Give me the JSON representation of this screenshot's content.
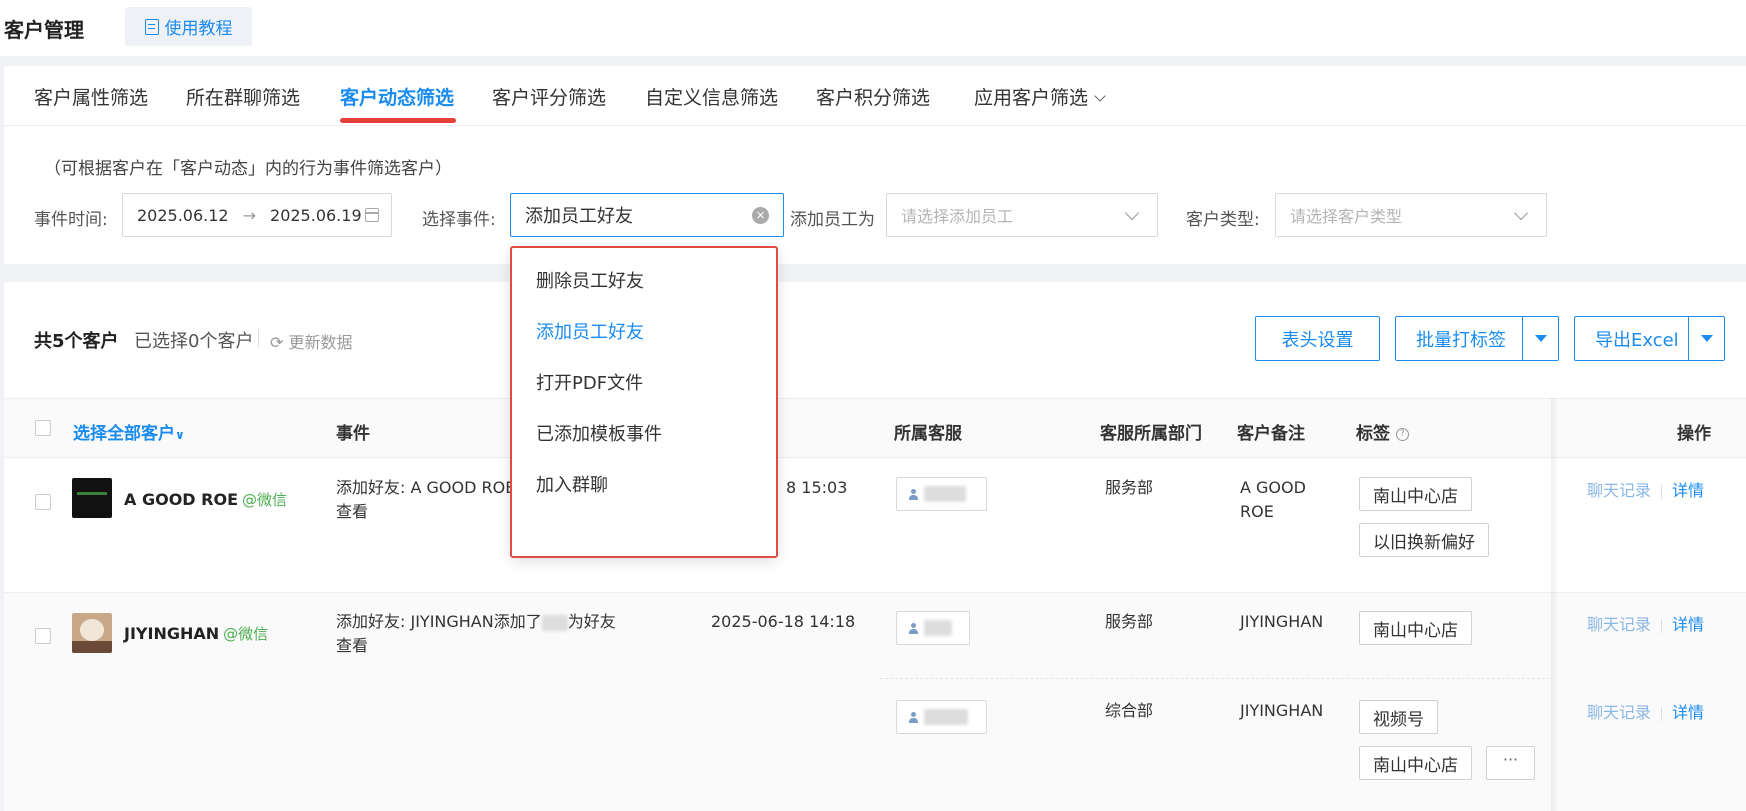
{
  "header": {
    "title": "客户管理",
    "tutorial_label": "使用教程"
  },
  "tabs": [
    {
      "label": "客户属性筛选"
    },
    {
      "label": "所在群聊筛选"
    },
    {
      "label": "客户动态筛选"
    },
    {
      "label": "客户评分筛选"
    },
    {
      "label": "自定义信息筛选"
    },
    {
      "label": "客户积分筛选"
    },
    {
      "label": "应用客户筛选"
    }
  ],
  "filters": {
    "hint": "（可根据客户在「客户动态」内的行为事件筛选客户）",
    "event_time_label": "事件时间:",
    "date_start": "2025.06.12",
    "date_sep": "→",
    "date_end": "2025.06.19",
    "event_label": "选择事件:",
    "event_value": "添加员工好友",
    "employee_label": "添加员工为",
    "employee_placeholder": "请选择添加员工",
    "customer_type_label": "客户类型:",
    "customer_type_placeholder": "请选择客户类型"
  },
  "dropdown": {
    "options": [
      "删除员工好友",
      "添加员工好友",
      "打开PDF文件",
      "已添加模板事件",
      "加入群聊"
    ],
    "selected": "添加员工好友"
  },
  "list": {
    "total_label": "共5个客户",
    "selected_label": "已选择0个客户",
    "refresh_label": "更新数据",
    "header_settings_label": "表头设置",
    "batch_tag_label": "批量打标签",
    "export_label": "导出Excel"
  },
  "table": {
    "columns": {
      "select_all": "选择全部客户",
      "event": "事件",
      "service": "所属客服",
      "department": "客服所属部门",
      "remark": "客户备注",
      "tags": "标签",
      "ops": "操作"
    },
    "rows": [
      {
        "name": "A GOOD ROE",
        "channel": "@微信",
        "event_line1": "添加好友: A GOOD ROE添",
        "event_line2": "查看",
        "time": "8 15:03",
        "department": "服务部",
        "remark_line1": "A GOOD",
        "remark_line2": "ROE",
        "tags": [
          "南山中心店",
          "以旧换新偏好"
        ],
        "op_chat": "聊天记录",
        "op_detail": "详情"
      },
      {
        "name": "JIYINGHAN",
        "channel": "@微信",
        "event_line1": "添加好友: JIYINGHAN添加了",
        "event_line1_suffix": "为好友",
        "event_line2": "查看",
        "time": "2025-06-18 14:18",
        "department": "服务部",
        "remark": "JIYINGHAN",
        "tags": [
          "南山中心店"
        ],
        "op_chat": "聊天记录",
        "op_detail": "详情"
      },
      {
        "department": "综合部",
        "remark": "JIYINGHAN",
        "tags": [
          "视频号",
          "南山中心店"
        ],
        "more": "···",
        "op_chat": "聊天记录",
        "op_detail": "详情"
      }
    ]
  },
  "colors": {
    "accent": "#1a8cf0",
    "highlight_border": "#e04b45",
    "wechat": "#4caf50"
  }
}
